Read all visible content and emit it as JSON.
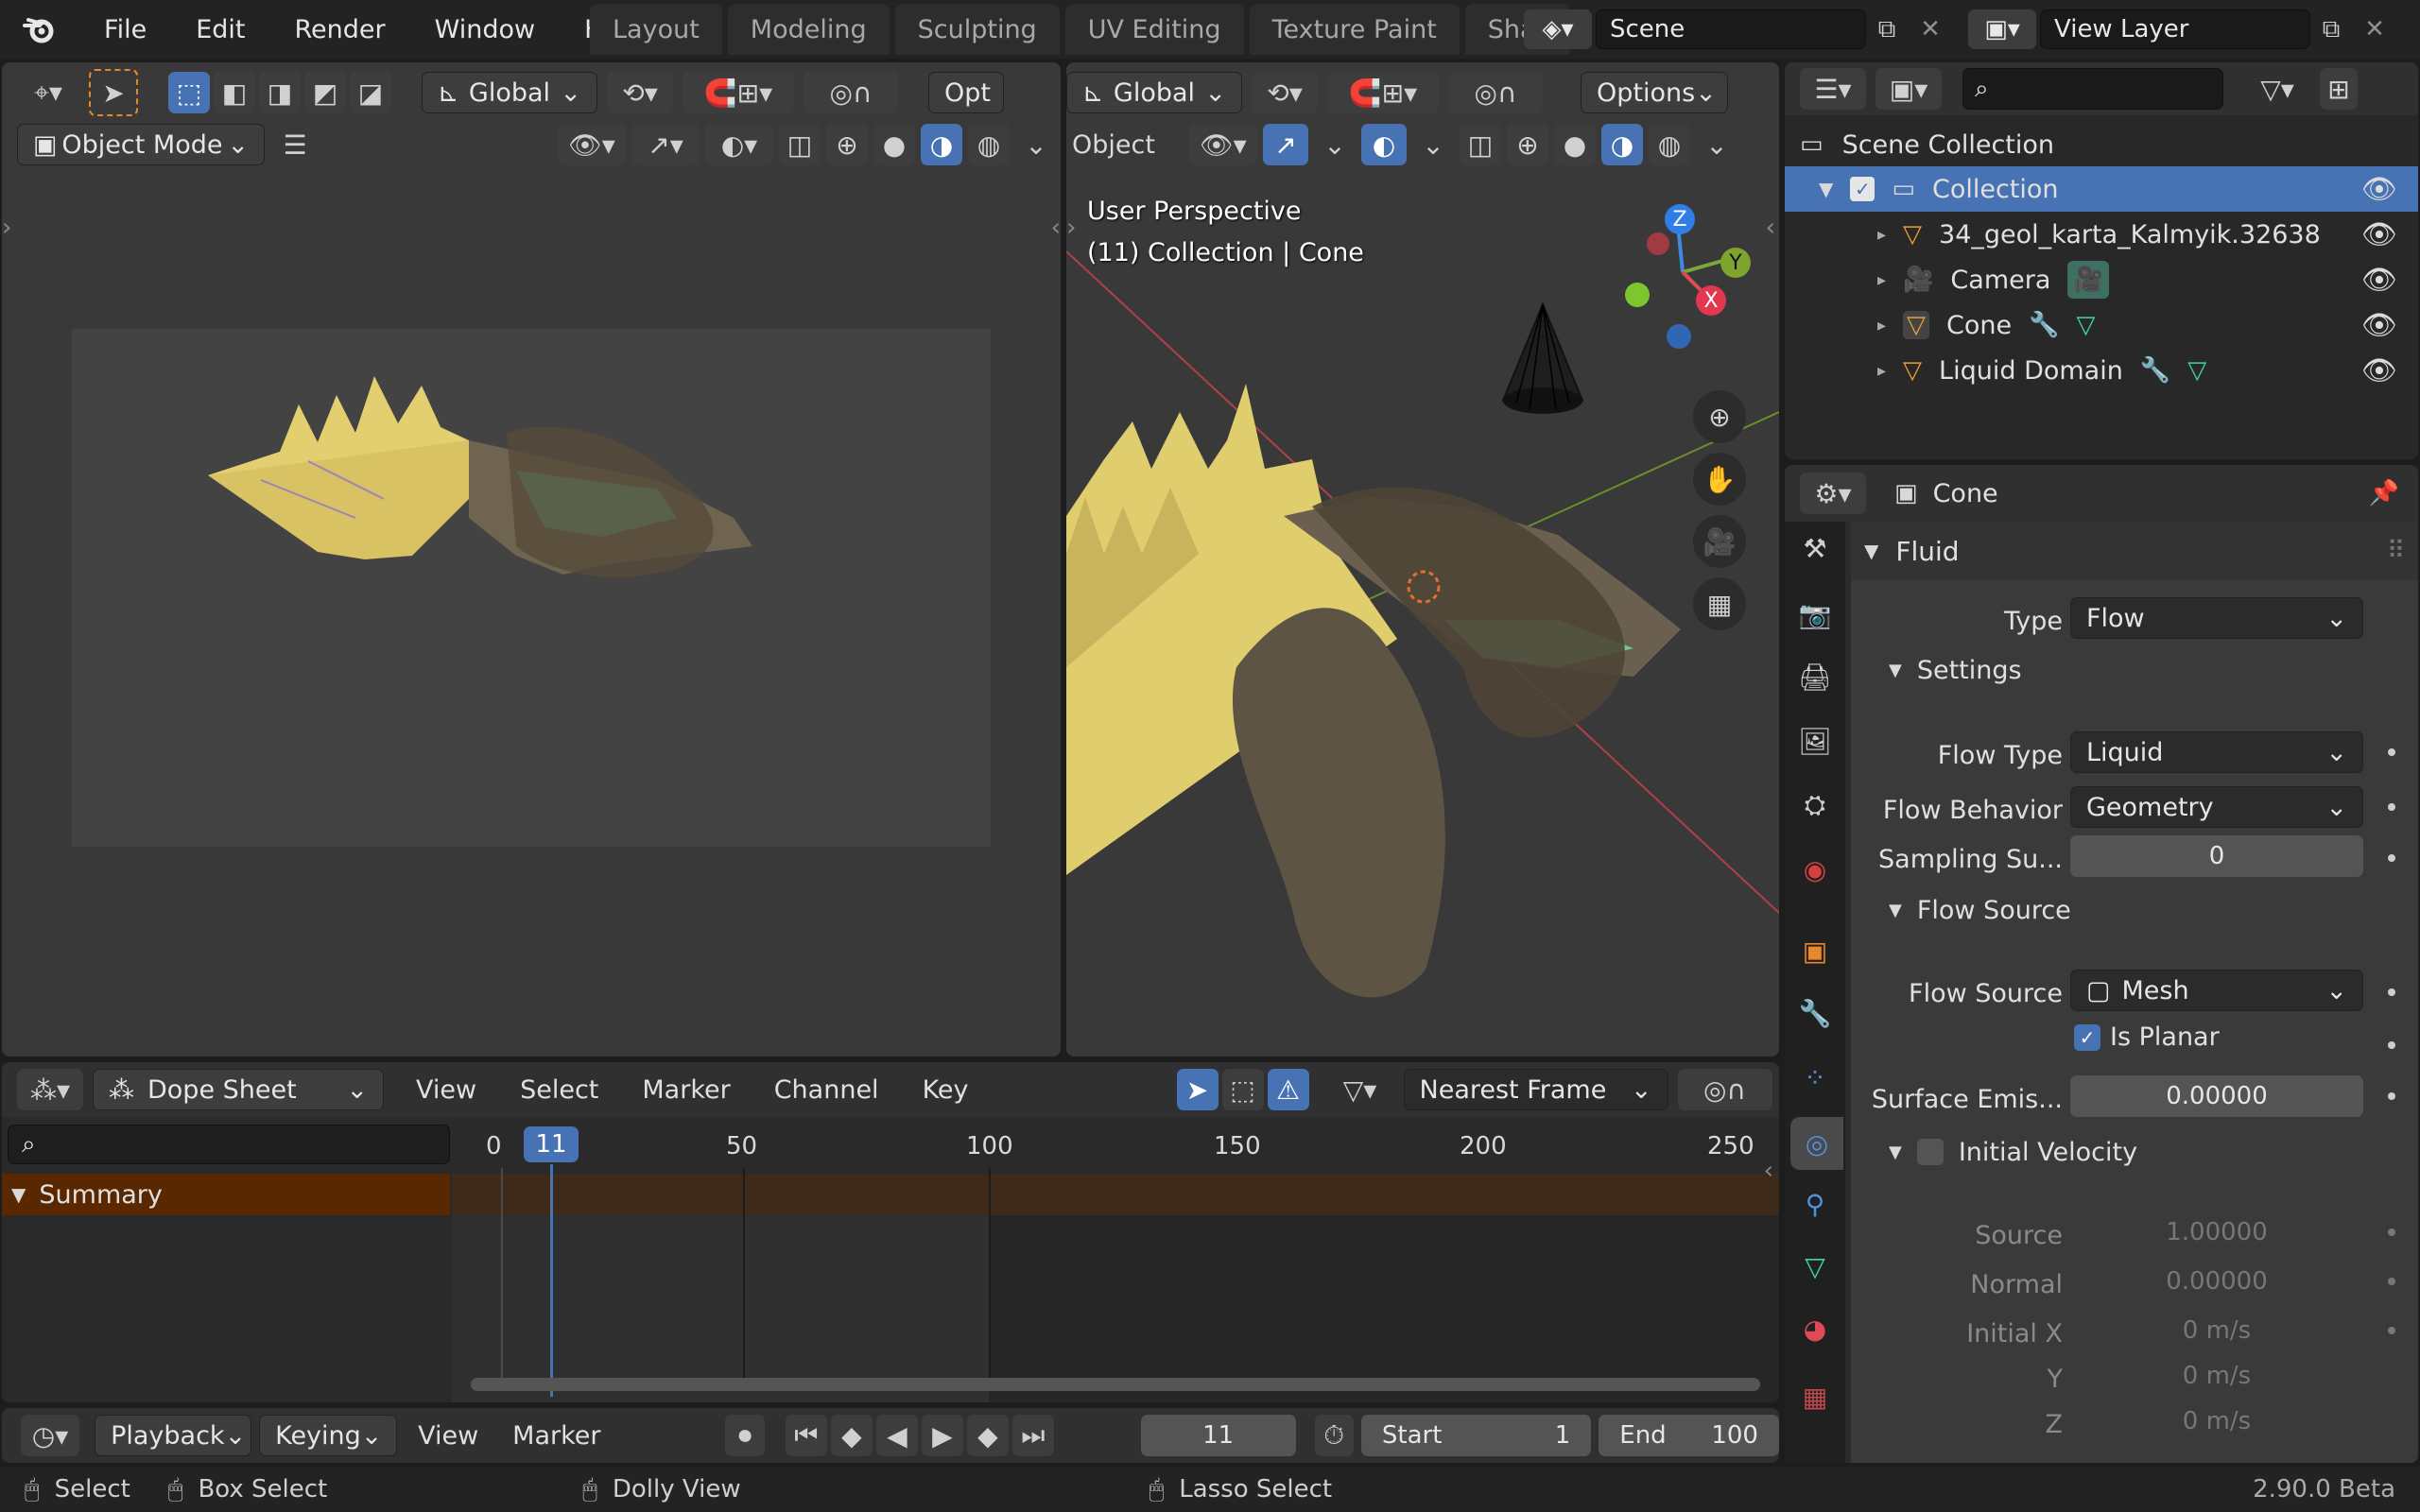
{
  "topbar": {
    "menus": [
      "File",
      "Edit",
      "Render",
      "Window",
      "Help"
    ],
    "workspaces": [
      "Layout",
      "Modeling",
      "Sculpting",
      "UV Editing",
      "Texture Paint",
      "Shadin"
    ],
    "scene": "Scene",
    "view_layer": "View Layer"
  },
  "left_viewport": {
    "orientation": "Global",
    "options_label": "Opt",
    "mode": "Object Mode"
  },
  "right_viewport": {
    "orientation": "Global",
    "options": "Options",
    "object_menu": "Object",
    "overlay_line1": "User Perspective",
    "overlay_line2": "(11) Collection | Cone",
    "axis_x": "X",
    "axis_y": "Y",
    "axis_z": "Z"
  },
  "outliner": {
    "scene_collection": "Scene Collection",
    "items": [
      {
        "label": "Collection",
        "selected": true
      },
      {
        "label": "34_geol_karta_Kalmyik.32638"
      },
      {
        "label": "Camera"
      },
      {
        "label": "Cone"
      },
      {
        "label": "Liquid Domain"
      }
    ]
  },
  "properties": {
    "object_name": "Cone",
    "panel": "Fluid",
    "type_label": "Type",
    "type_value": "Flow",
    "settings": "Settings",
    "flow_type_label": "Flow Type",
    "flow_type_value": "Liquid",
    "flow_behavior_label": "Flow Behavior",
    "flow_behavior_value": "Geometry",
    "sampling_label": "Sampling Su...",
    "sampling_value": "0",
    "flow_source_section": "Flow Source",
    "flow_source_label": "Flow Source",
    "flow_source_value": "Mesh",
    "is_planar": "Is Planar",
    "surface_label": "Surface Emis...",
    "surface_value": "0.00000",
    "initial_velocity": "Initial Velocity",
    "source_label": "Source",
    "source_value": "1.00000",
    "normal_label": "Normal",
    "normal_value": "0.00000",
    "ix_label": "Initial X",
    "ix_value": "0 m/s",
    "y_label": "Y",
    "y_value": "0 m/s",
    "z_label": "Z",
    "z_value": "0 m/s"
  },
  "dopesheet": {
    "editor": "Dope Sheet",
    "menus": [
      "View",
      "Select",
      "Marker",
      "Channel",
      "Key"
    ],
    "snap": "Nearest Frame",
    "summary": "Summary",
    "ruler": [
      "0",
      "50",
      "100",
      "150",
      "200",
      "250"
    ],
    "current_frame": "11"
  },
  "timeline": {
    "playback": "Playback",
    "keying": "Keying",
    "view": "View",
    "marker": "Marker",
    "frame": "11",
    "start_label": "Start",
    "start": "1",
    "end_label": "End",
    "end": "100"
  },
  "statusbar": {
    "select": "Select",
    "box_select": "Box Select",
    "dolly": "Dolly View",
    "lasso": "Lasso Select",
    "version": "2.90.0 Beta"
  }
}
